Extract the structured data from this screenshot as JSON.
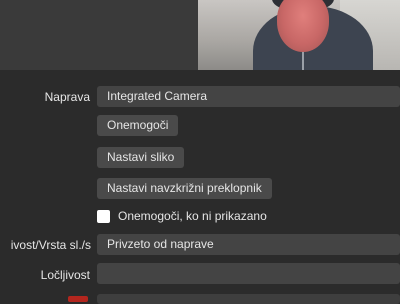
{
  "device": {
    "label": "Naprava",
    "value": "Integrated Camera"
  },
  "buttons": {
    "disable": "Onemogoči",
    "configure_video": "Nastavi sliko",
    "configure_crossbar": "Nastavi navzkrižni preklopnik"
  },
  "deactivate_when_hidden": {
    "label": "Onemogoči, ko ni prikazano",
    "checked": false
  },
  "resolution_type": {
    "label": "ivost/Vrsta sl./s",
    "value": "Privzeto od naprave"
  },
  "resolution": {
    "label": "Ločljivost",
    "value": ""
  }
}
